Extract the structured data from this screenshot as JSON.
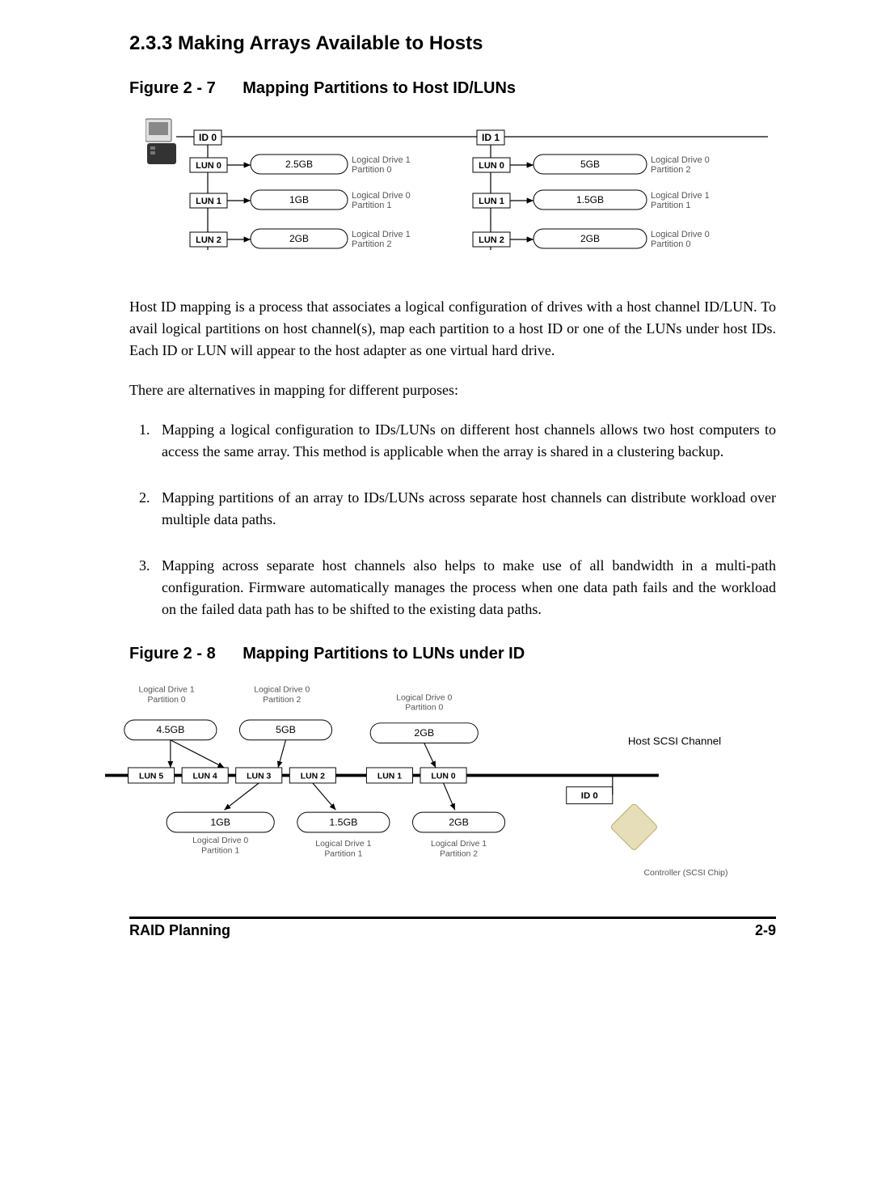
{
  "section_heading": "2.3.3  Making Arrays Available to Hosts",
  "figure27": {
    "label": "Figure 2 - 7",
    "title": "Mapping Partitions to Host ID/LUNs",
    "id0_label": "ID 0",
    "id1_label": "ID 1",
    "col1": {
      "lun0": {
        "lun": "LUN 0",
        "size": "2.5GB",
        "desc1": "Logical Drive 1",
        "desc2": "Partition 0"
      },
      "lun1": {
        "lun": "LUN 1",
        "size": "1GB",
        "desc1": "Logical Drive 0",
        "desc2": "Partition 1"
      },
      "lun2": {
        "lun": "LUN 2",
        "size": "2GB",
        "desc1": "Logical Drive 1",
        "desc2": "Partition 2"
      }
    },
    "col2": {
      "lun0": {
        "lun": "LUN 0",
        "size": "5GB",
        "desc1": "Logical Drive 0",
        "desc2": "Partition 2"
      },
      "lun1": {
        "lun": "LUN 1",
        "size": "1.5GB",
        "desc1": "Logical Drive 1",
        "desc2": "Partition 1"
      },
      "lun2": {
        "lun": "LUN 2",
        "size": "2GB",
        "desc1": "Logical Drive 0",
        "desc2": "Partition 0"
      }
    }
  },
  "para1": "Host ID mapping is a process that associates a logical configuration of drives with a host channel ID/LUN.  To avail logical partitions on host channel(s), map each partition to a host ID or one of the LUNs under host IDs.  Each ID or LUN will appear to the host adapter as one virtual hard drive.",
  "para2": "There are alternatives in mapping for different purposes:",
  "list": {
    "item1": "Mapping a logical configuration to IDs/LUNs on different host channels allows two host computers to access the same array.  This method is applicable when the array is shared in a clustering backup.",
    "item2": "Mapping partitions of an array to IDs/LUNs across separate host channels can distribute workload over multiple data paths.",
    "item3": "Mapping across separate host channels also helps to make use of all bandwidth in a multi-path configuration.  Firmware automatically manages the process when one data path fails and the workload on the failed data path has to be shifted to the existing data paths."
  },
  "figure28": {
    "label": "Figure 2 - 8",
    "title": "Mapping Partitions to LUNs under ID",
    "top": {
      "ld1p0": {
        "l1": "Logical Drive 1",
        "l2": "Partition 0",
        "size": "4.5GB"
      },
      "ld0p2": {
        "l1": "Logical Drive 0",
        "l2": "Partition 2",
        "size": "5GB"
      },
      "ld0p0": {
        "l1": "Logical Drive 0",
        "l2": "Partition 0",
        "size": "2GB"
      }
    },
    "host_label": "Host SCSI Channel",
    "luns": {
      "l5": "LUN 5",
      "l4": "LUN 4",
      "l3": "LUN 3",
      "l2": "LUN 2",
      "l1": "LUN 1",
      "l0": "LUN 0"
    },
    "id0": "ID 0",
    "bottom": {
      "b1": {
        "size": "1GB",
        "l1": "Logical Drive 0",
        "l2": "Partition 1"
      },
      "b2": {
        "size": "1.5GB",
        "l1": "Logical Drive 1",
        "l2": "Partition 1"
      },
      "b3": {
        "size": "2GB",
        "l1": "Logical Drive 1",
        "l2": "Partition 2"
      }
    },
    "controller": "Controller (SCSI Chip)"
  },
  "footer": {
    "left": "RAID Planning",
    "right": "2-9"
  }
}
